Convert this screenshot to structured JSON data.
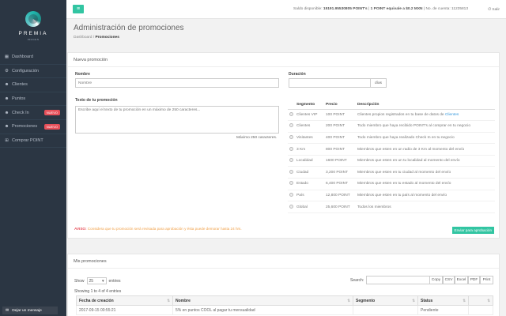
{
  "brand": {
    "name": "PREMIA",
    "tagline": "IMAGEN"
  },
  "sidebar": {
    "items": [
      {
        "label": "Dashboard",
        "icon": "dashboard-icon"
      },
      {
        "label": "Configuración",
        "icon": "gear-icon"
      },
      {
        "label": "Clientes",
        "icon": "users-icon"
      },
      {
        "label": "Puntos",
        "icon": "users-icon"
      },
      {
        "label": "Check In",
        "icon": "users-icon",
        "badge": "NUEVO"
      },
      {
        "label": "Promociones",
        "icon": "users-icon",
        "badge": "NUEVO"
      },
      {
        "label": "Comprar POINT",
        "icon": "cart-icon"
      }
    ],
    "feedback_label": "Dejar un mensaje"
  },
  "topbar": {
    "saldo_label": "Saldo disponible:",
    "saldo_value": "15191.95530805 POINT's",
    "rate": "1 POINT equivale a $0.2 MXN",
    "account": "No. de cuenta: 11235813",
    "logout": "Salir"
  },
  "page": {
    "title": "Administración de promociones",
    "breadcrumb_home": "Dashboard",
    "breadcrumb_current": "Promociones"
  },
  "form": {
    "panel_title": "Nueva promoción",
    "nombre_label": "Nombre",
    "nombre_placeholder": "Nombre",
    "duracion_label": "Duración",
    "duracion_addon": "días",
    "texto_label": "Texto de tu promoción",
    "texto_placeholder": "Escribe aquí el texto de tu promoción en un máximo de 250 caracteres...",
    "maxlen_note": "Máximo 250 caracteres.",
    "aviso_label": "AVISO:",
    "aviso_text": "Considera que tu promoción será revisada para aprobación y ésta puede demorar hasta 24 hrs.",
    "submit_label": "Enviar para aprobación"
  },
  "segments": {
    "headers": [
      "Segmento",
      "Precio",
      "Descripción"
    ],
    "rows": [
      {
        "segment": "Clientes VIP",
        "price": "100 POINT",
        "desc": "Clientes propios registrados en tu base de datos de",
        "link": "Clientes"
      },
      {
        "segment": "Clientes",
        "price": "200 POINT",
        "desc": "Todo miembro que haya recibido POINT's al comprar en tu negocio"
      },
      {
        "segment": "Visitantes",
        "price": "400 POINT",
        "desc": "Todo miembro que haya realizado Check In en tu negocio"
      },
      {
        "segment": "3 Km",
        "price": "800 POINT",
        "desc": "Miembros que esten en un radio de 3 Km al momento del envío"
      },
      {
        "segment": "Localidad",
        "price": "1600 POINT",
        "desc": "Miembros que esten en un tu localidad al momento del envío"
      },
      {
        "segment": "Ciudad",
        "price": "3,200 POINT",
        "desc": "Miembros que esten en tu ciudad al momento del envío"
      },
      {
        "segment": "Estado",
        "price": "6,400 POINT",
        "desc": "Miembros que esten en tu estado al momento del envío"
      },
      {
        "segment": "País",
        "price": "12,800 POINT",
        "desc": "Miembros que esten en tu país al momento del envío"
      },
      {
        "segment": "Global",
        "price": "25,600 POINT",
        "desc": "Todos los miembros"
      }
    ]
  },
  "list": {
    "panel_title": "Mis promociones",
    "show_label": "Show",
    "show_value": "25",
    "entries_label": "entries",
    "search_label": "Search:",
    "buttons": [
      "Copy",
      "CSV",
      "Excel",
      "PDF",
      "Print"
    ],
    "showing_text": "Showing 1 to 4 of 4 entries",
    "columns": [
      "Fecha de creación",
      "Nombre",
      "Segmento",
      "Status",
      ""
    ],
    "rows": [
      [
        "2017-09-15 00:55:21",
        "5% en puntos COOL al pagar tu mensualidad",
        "",
        "Pendiente",
        ""
      ]
    ]
  }
}
